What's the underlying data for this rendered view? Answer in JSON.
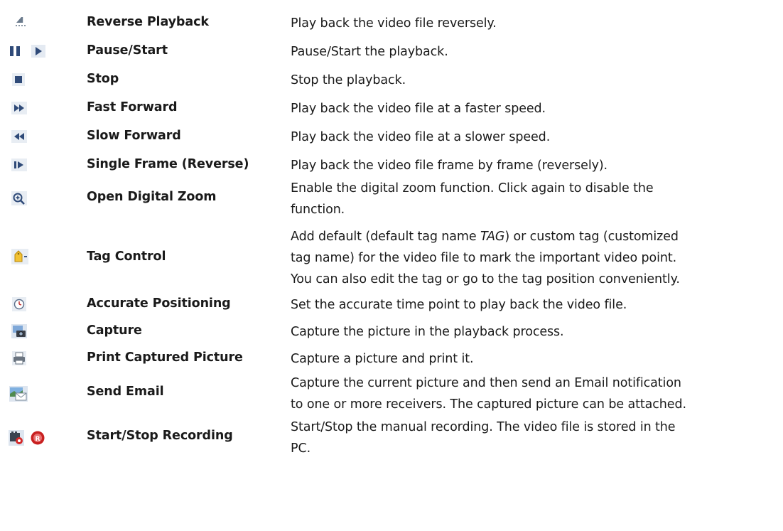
{
  "rows": [
    {
      "name": "Reverse Playback",
      "icon": "reverse-playback-icon",
      "desc": [
        "Play back the video file reversely."
      ]
    },
    {
      "name": "Pause/Start",
      "icon": [
        "pause-icon",
        "play-icon"
      ],
      "desc": [
        "Pause/Start the playback."
      ]
    },
    {
      "name": "Stop",
      "icon": "stop-icon",
      "desc": [
        "Stop the playback."
      ]
    },
    {
      "name": "Fast Forward",
      "icon": "fast-forward-icon",
      "desc": [
        "Play back the video file at a faster speed."
      ]
    },
    {
      "name": "Slow Forward",
      "icon": "slow-forward-icon",
      "desc": [
        "Play back the video file at a slower speed."
      ]
    },
    {
      "name": "Single Frame (Reverse)",
      "icon": "single-frame-icon",
      "desc": [
        "Play back the video file frame by frame (reversely)."
      ]
    },
    {
      "name": "Open Digital Zoom",
      "icon": "digital-zoom-icon",
      "desc": [
        "Enable the digital zoom function. Click again to disable the",
        "function."
      ]
    },
    {
      "name": "Tag Control",
      "icon": "tag-control-icon",
      "desc_line1_pre": "Add default (default tag name ",
      "desc_line1_em": "TAG",
      "desc_line1_post": ") or custom tag (customized",
      "desc": [
        "tag name) for the video file to mark the important video point.",
        "You can also edit the tag or go to the tag position conveniently."
      ]
    },
    {
      "name": "Accurate Positioning",
      "icon": "clock-icon",
      "desc": [
        "Set the accurate time point to play back the video file."
      ]
    },
    {
      "name": "Capture",
      "icon": "camera-icon",
      "desc": [
        "Capture the picture in the playback process."
      ]
    },
    {
      "name": "Print Captured Picture",
      "icon": "printer-icon",
      "desc": [
        "Capture a picture and print it."
      ]
    },
    {
      "name": "Send Email",
      "icon": "email-icon",
      "desc": [
        "Capture the current picture and then send an Email notification",
        "to one or more receivers. The captured picture can be attached."
      ]
    },
    {
      "name": "Start/Stop Recording",
      "icon": [
        "start-recording-icon",
        "stop-recording-icon"
      ],
      "desc": [
        "Start/Stop the manual recording. The video file is stored in the",
        "PC."
      ]
    }
  ]
}
